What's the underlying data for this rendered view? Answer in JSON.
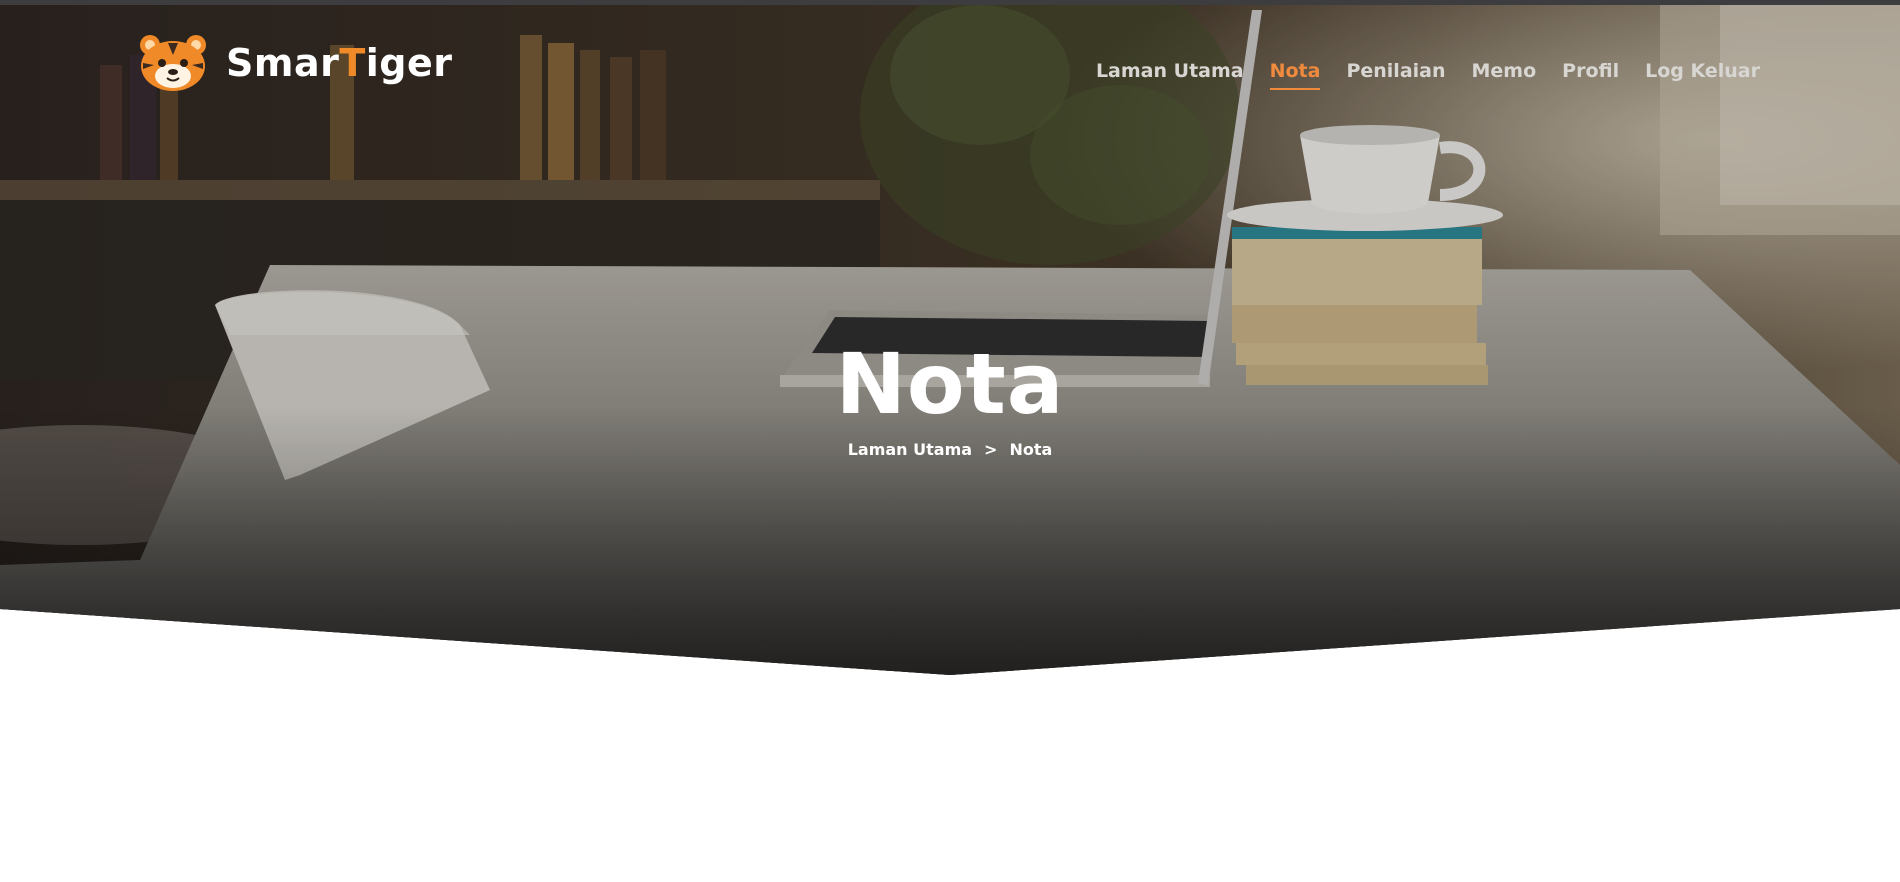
{
  "brand": {
    "name_prefix": "Smar",
    "name_accent": "T",
    "name_suffix": "iger"
  },
  "nav": {
    "items": [
      {
        "label": "Laman Utama",
        "active": false
      },
      {
        "label": "Nota",
        "active": true
      },
      {
        "label": "Penilaian",
        "active": false
      },
      {
        "label": "Memo",
        "active": false
      },
      {
        "label": "Profil",
        "active": false
      },
      {
        "label": "Log Keluar",
        "active": false
      }
    ]
  },
  "hero": {
    "title": "Nota",
    "breadcrumb": {
      "home": "Laman Utama",
      "separator": ">",
      "current": "Nota"
    }
  },
  "colors": {
    "accent": "#f08a3e",
    "nav_text": "#d8d6d2",
    "hero_text": "#ffffff",
    "topbar": "#3d3d3f"
  }
}
